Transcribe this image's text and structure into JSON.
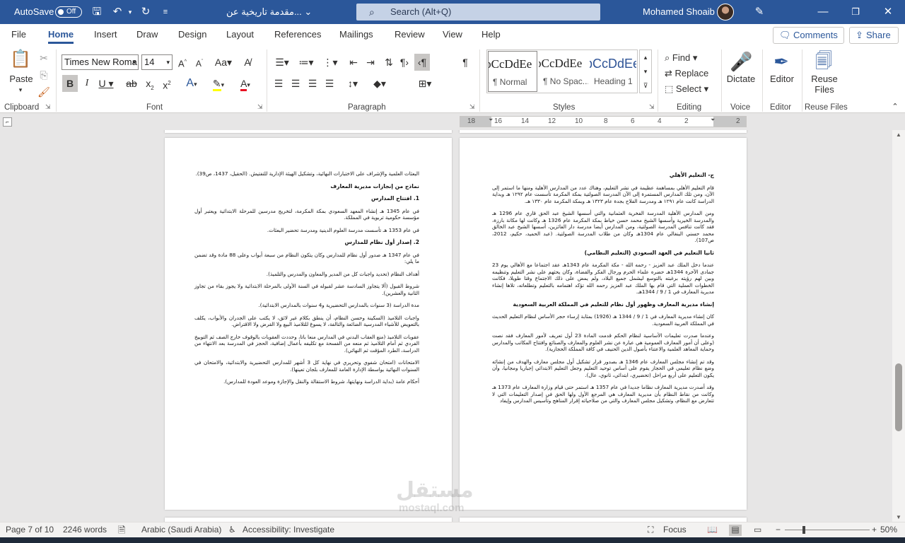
{
  "title_bar": {
    "autosave_label": "AutoSave",
    "autosave_state": "Off",
    "document_title": "مقدمة تاريخية عن...",
    "search_placeholder": "Search (Alt+Q)",
    "user_name": "Mohamed Shoaib",
    "icons": [
      "save-icon",
      "undo-icon",
      "redo-icon",
      "customize-qat-icon",
      "pen-icon",
      "minimize-icon",
      "restore-icon",
      "close-icon"
    ],
    "accent_color": "#2b579a"
  },
  "menu": {
    "tabs": [
      "File",
      "Home",
      "Insert",
      "Draw",
      "Design",
      "Layout",
      "References",
      "Mailings",
      "Review",
      "View",
      "Help"
    ],
    "active_tab": "Home",
    "comments_label": "Comments",
    "share_label": "Share"
  },
  "ribbon": {
    "clipboard": {
      "label": "Clipboard",
      "paste_label": "Paste"
    },
    "font": {
      "label": "Font",
      "font_name": "Times New Roma",
      "font_size": "14"
    },
    "paragraph": {
      "label": "Paragraph"
    },
    "styles": {
      "label": "Styles",
      "items": [
        {
          "sample": "AaBbCcDdEe",
          "name": "¶ Normal"
        },
        {
          "sample": "AaBbCcDdEe",
          "name": "¶ No Spac..."
        },
        {
          "sample": "AaBbCcDdEe",
          "name": "Heading 1"
        }
      ]
    },
    "editing": {
      "label": "Editing",
      "find": "Find",
      "replace": "Replace",
      "select": "Select"
    },
    "voice": {
      "label": "Voice",
      "dictate": "Dictate"
    },
    "editor": {
      "label": "Editor",
      "editor": "Editor"
    },
    "reuse": {
      "label": "Reuse Files",
      "reuse_files_1": "Reuse",
      "reuse_files_2": "Files"
    }
  },
  "ruler": {
    "ticks": [
      "18",
      "16",
      "14",
      "12",
      "10",
      "8",
      "6",
      "4",
      "2",
      "2"
    ]
  },
  "document": {
    "right_page": {
      "heading1": "ج-   التعليم الأهلي",
      "p1": "قام التعليم الأهلي بمساهمة عظيمة في نشر التعليم، وهناك عدد من المدارس الأهلية ومنها ما استمر إلى الآن، ومن تلك المدارس المستمرة إلى الآن المدرسة الصولتية بمكة المكرمة تأسست عام ١٢٩٢ هـ وبداية الدراسة كانت عام ١٢٩١ هـ ومدرسة الفلاح بجدة عام ١٣٢٣ هـ وبمكة المكرمة عام ١٣٣٠ هـ.",
      "p2": "ومن المدارس الأهلية المدرسة الفخرية العثمانية والتي أسسها الشيخ عبد الحق قاري عام 1296 هـ والمدرسة الخيرية وأسسها الشيخ محمد حسن خياط بمكة المكرمة عام 1326 هـ وكانت لها مكانة بارزة، فقد كانت تنافس المدرسة الصولتية، ومن المدارس أيضا مدرسة دار الفائزين، أسسها الشيخ عبد الخالق محمد حسني البنغالي عام 1304هـ وكان من طلاب المدرسة الصولتية. (عبد الحميد، حكيم، 2012، ص107).",
      "heading2": "ثانيا التعليم في العهد السعودي (التعليم النظامي)",
      "p3": "عندما دخل الملك عبد العزيز - رحمه الله - مكة المكرمة عام 1343هـ عقد اجتماعا مع الأهالي يوم 23 جمادى الآخرة 1344هـ حضره علماء الحرم ورجال الفكر والقضاة، وكان يحثهم على نشر التعليم وتنظيمه وبين لهم رؤيته برغبته بالتوسع ليشمل جميع البلاد، ولم يمض على ذلك الاجتماع وقتا طويلا، فكانت الخطوات العملية التي قام بها الملك عبد العزيز رحمه الله تؤكد اهتمامه بالتعليم وتطلعاته، تلاها إنشاء مديرية المعارف في 1 / 9 / 1344هـ.",
      "heading3": "إنشاء مديرية المعارف وظهور أول نظام للتعليم في المملكة العربية السعودية",
      "p4": "كان إنشاء مديرية المعارف في 1 / 9 / 1344 هـ (1926) بمثابة إرساء حجر الأساس لنظام التعليم الحديث في المملكة العربية السعودية.",
      "p5": "وعندما صدرت تعليمات الأساسية لنظام الحكم قدمت المادة 23 أول تعريف لأمور المعارف فقد نصت (وعلى أن أمور المعارف العمومية هي عبارة عن نشر العلوم والمعارف والصنائع وافتتاح المكاتب والمدارس وحماية المعاهد العلمية والاعتناء بأصول الدين الحنيف في كافة المملكة الحجازية).",
      "p6": "وقد تم إنشاء مجلس المعارف عام 1346 هـ بصدور قرار تشكيل أول مجلس معارف والهدف من إنشائه وضع نظام تعليمي في الحجاز يقوم على أساس توحيد التعليم وجعل التعليم الابتدائي إجباريا ومجانيا، وأن يكون التعليم على أربع مراحل (تحضيري، ابتدائي، ثانوي، عال).",
      "p7": "وقد أصدرت مديرية المعارف نظاما جديدا في عام 1357 هـ استمر حتى قيام وزارة المعارف عام 1373 هـ وكانت من نقاط النظام بأن مديرية المعارف هي المرجع الأول ولها الحق في إصدار التعليمات التي لا تتعارض مع النظام، وتشكيل مجلس المعارف والتي من صلاحياته إقرار المناهج وتأسيس المدارس وإيفاد"
    },
    "left_page": {
      "p1": "البعثات العلمية والإشراف على الاختبارات النهائية، وتشكيل الهيئة الإدارية للتفتيش. (الحقيل، 1437، ص39).",
      "heading1": "نماذج من إنجازات مديرية المعارف",
      "item1": "1.   افتتاح المدارس",
      "p2": "في عام 1345 هـ إنشاء المعهد السعودي بمكة المكرمة، لتخريج مدرسين للمرحلة الابتدائية ويعتبر أول مؤسسة حكومية تربوية في المملكة.",
      "p3": "في عام 1353 هـ تأسست مدرسة العلوم الدينية ومدرسة تحضير البعثات.",
      "item2": "2.   إصدار أول نظام للمدارس",
      "p4": "في عام 1347 هـ صدور أول نظام للمدارس وكان يتكون النظام من سبعة أبواب وعلى 88 مادة وقد تضمن ما يلي:",
      "p5": "أهداف النظام (تحديد واجبات كل من المدير والمعاون والمدرس والتلميذ).",
      "p6": "شروط القبول (ألا يتجاوز السادسة عشر لقبوله في السنة الأولى بالمرحلة الابتدائية ولا يجوز بقاء من تجاوز الثانية والعشرين).",
      "p7": "مدة الدراسة (3 سنوات بالمدارس التحضيرية و4 سنوات بالمدارس الابتدائية).",
      "p8": "واجبات التلاميذ (السكينة وحسن النظام، أن ينطق بكلام غير لائق، لا يكتب على الجدران والأبواب، يكلف بالتعويض للأشياء المدرسية الضائعة والتالفة، لا يسوغ للتلاميذ البيع ولا القرض ولا الاقتراض.",
      "p9": "عقوبات التلاميذ (منع العقاب البدني في المدارس منعا باتا، وحددت العقوبات بالوقوف خارج الصف ثم التوبيخ الفردي ثم أمام التلاميذ ثم منعه من الفسحة مع تكليفه بأعمال إضافية، الحجز في المدرسة بعد الانتهاء من الدراسة، الطرد المؤقت ثم النهائي).",
      "p10": "الامتحانات (امتحان شفوي وتحريري في نهاية كل 3 أشهر للمدارس التحضيرية والابتدائية، والامتحان في السنوات النهائية بواسطة الإدارة العامة للمعارف بلجان تعينها).",
      "p11": "أحكام عامة (بداية الدراسة ونهايتها، شروط الاستقالة والنقل والإجازة وموعد العودة للمدارس)."
    }
  },
  "watermark": {
    "arabic": "مستقل",
    "latin": "mostaql.com"
  },
  "status_bar": {
    "page": "Page 7 of 10",
    "words": "2246 words",
    "language": "Arabic (Saudi Arabia)",
    "accessibility": "Accessibility: Investigate",
    "focus": "Focus",
    "zoom": "50%",
    "zoom_level_fraction": 0.5
  }
}
